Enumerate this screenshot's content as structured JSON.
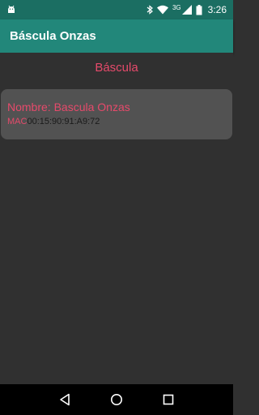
{
  "status_bar": {
    "network": "3G",
    "time": "3:26",
    "icons": [
      "android-notification-icon",
      "bluetooth-icon",
      "wifi-icon",
      "cell-signal-icon",
      "battery-icon"
    ]
  },
  "app_bar": {
    "title": "Báscula Onzas"
  },
  "main": {
    "section_title": "Báscula",
    "devices": [
      {
        "name": "Nombre: Bascula Onzas",
        "mac_label": "MAC",
        "mac": "00:15:90:91:A9:72"
      }
    ]
  },
  "nav_bar": {
    "buttons": [
      "back-button",
      "home-button",
      "recents-button"
    ]
  },
  "colors": {
    "status_bar": "#1b6e62",
    "app_bar": "#22877a",
    "background": "#303030",
    "card": "#525252",
    "accent_pink": "#e64a6b"
  }
}
